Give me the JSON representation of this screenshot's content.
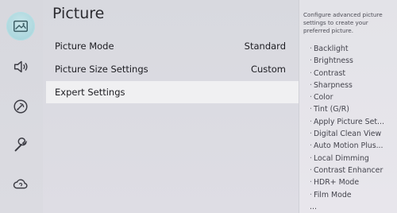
{
  "main": {
    "title": "Picture",
    "rows": [
      {
        "label": "Picture Mode",
        "value": "Standard"
      },
      {
        "label": "Picture Size Settings",
        "value": "Custom"
      },
      {
        "label": "Expert Settings",
        "value": ""
      }
    ]
  },
  "info": {
    "description": "Configure advanced picture settings to create your preferred picture.",
    "items": [
      "Backlight",
      "Brightness",
      "Contrast",
      "Sharpness",
      "Color",
      "Tint (G/R)",
      "Apply Picture Set...",
      "Digital Clean View",
      "Auto Motion Plus...",
      "Local Dimming",
      "Contrast Enhancer",
      "HDR+ Mode",
      "Film Mode",
      "..."
    ]
  },
  "rail": {
    "icons": [
      "picture-icon",
      "sound-icon",
      "broadcasting-icon",
      "general-icon",
      "support-icon"
    ],
    "accent": "#a7d6dd"
  }
}
